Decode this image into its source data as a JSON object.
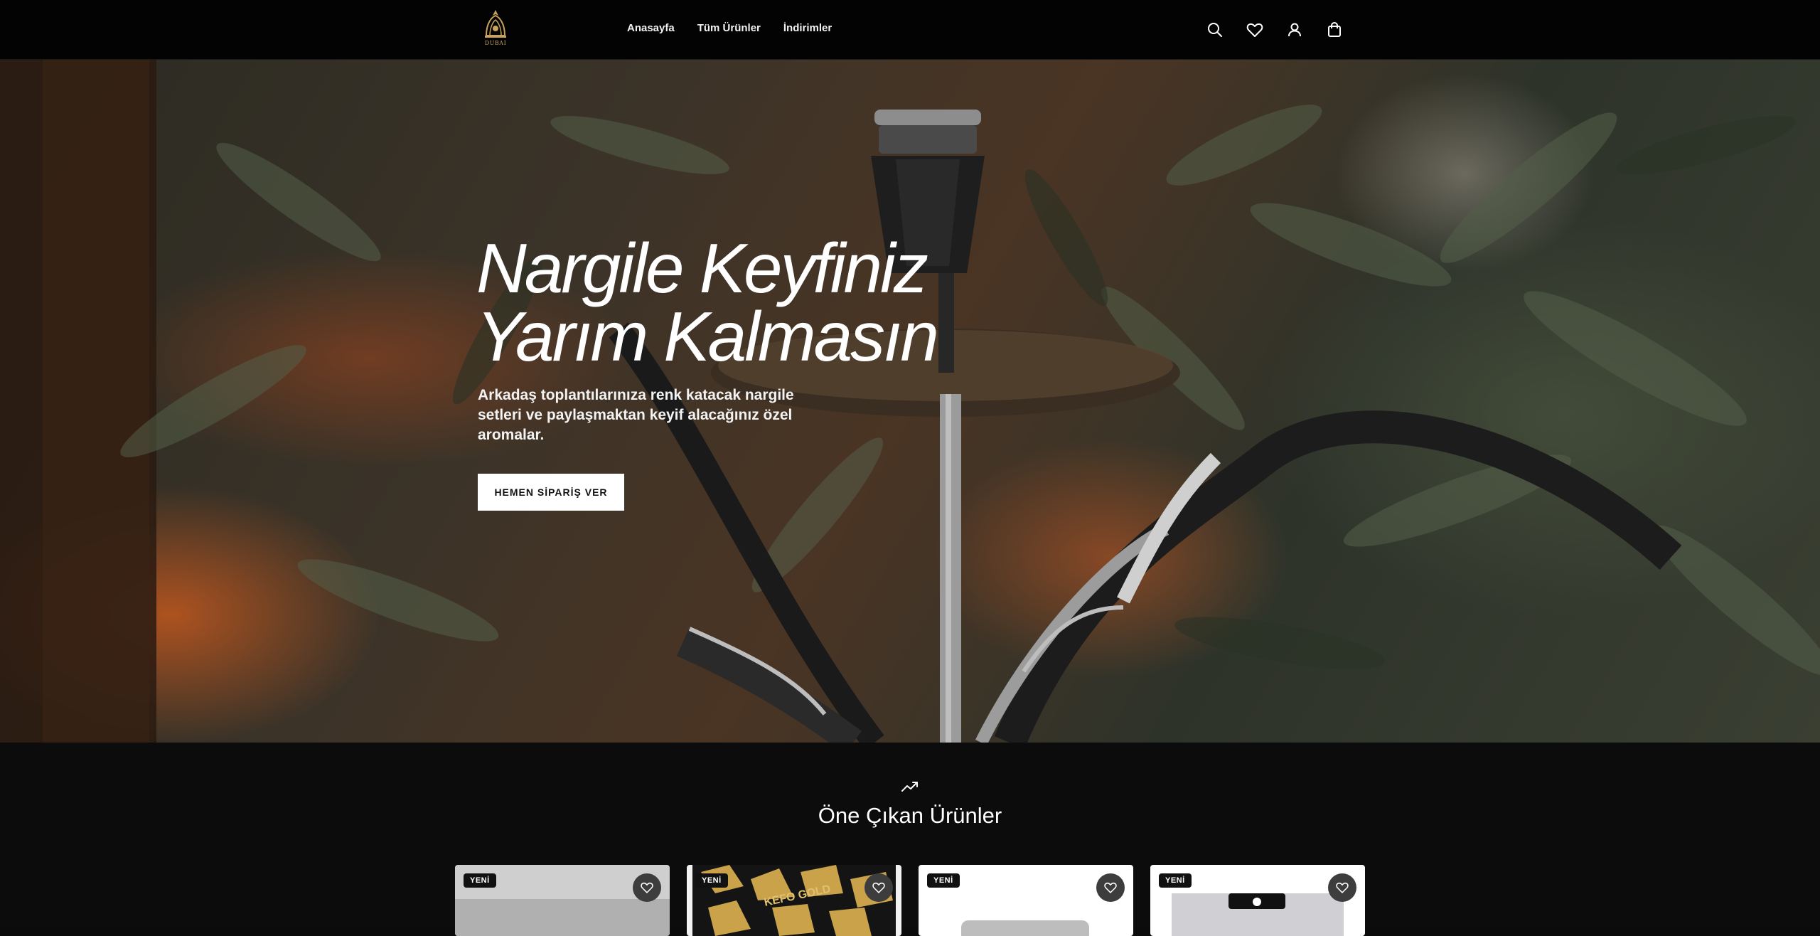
{
  "brand": {
    "logo_text": "DUBAI"
  },
  "nav": {
    "items": [
      {
        "label": "Anasayfa"
      },
      {
        "label": "Tüm Ürünler"
      },
      {
        "label": "İndirimler"
      }
    ]
  },
  "header_icons": [
    "search-icon",
    "heart-icon",
    "user-icon",
    "shopping-bag-icon"
  ],
  "hero": {
    "title_line1": "Nargile Keyfiniz",
    "title_line2": "Yarım Kalmasın",
    "subtitle": "Arkadaş toplantılarınıza renk katacak nargile setleri ve paylaşmaktan keyif alacağınız özel aromalar.",
    "cta_label": "HEMEN SİPARİŞ VER"
  },
  "featured": {
    "title": "Öne Çıkan Ürünler",
    "products": [
      {
        "badge": "YENİ"
      },
      {
        "badge": "YENİ"
      },
      {
        "badge": "YENİ"
      },
      {
        "badge": "YENİ"
      }
    ]
  },
  "colors": {
    "header_bg": "#030303",
    "page_bg": "#0c0c0c",
    "cta_bg": "#ffffff",
    "logo_gold": "#c9a35b"
  }
}
